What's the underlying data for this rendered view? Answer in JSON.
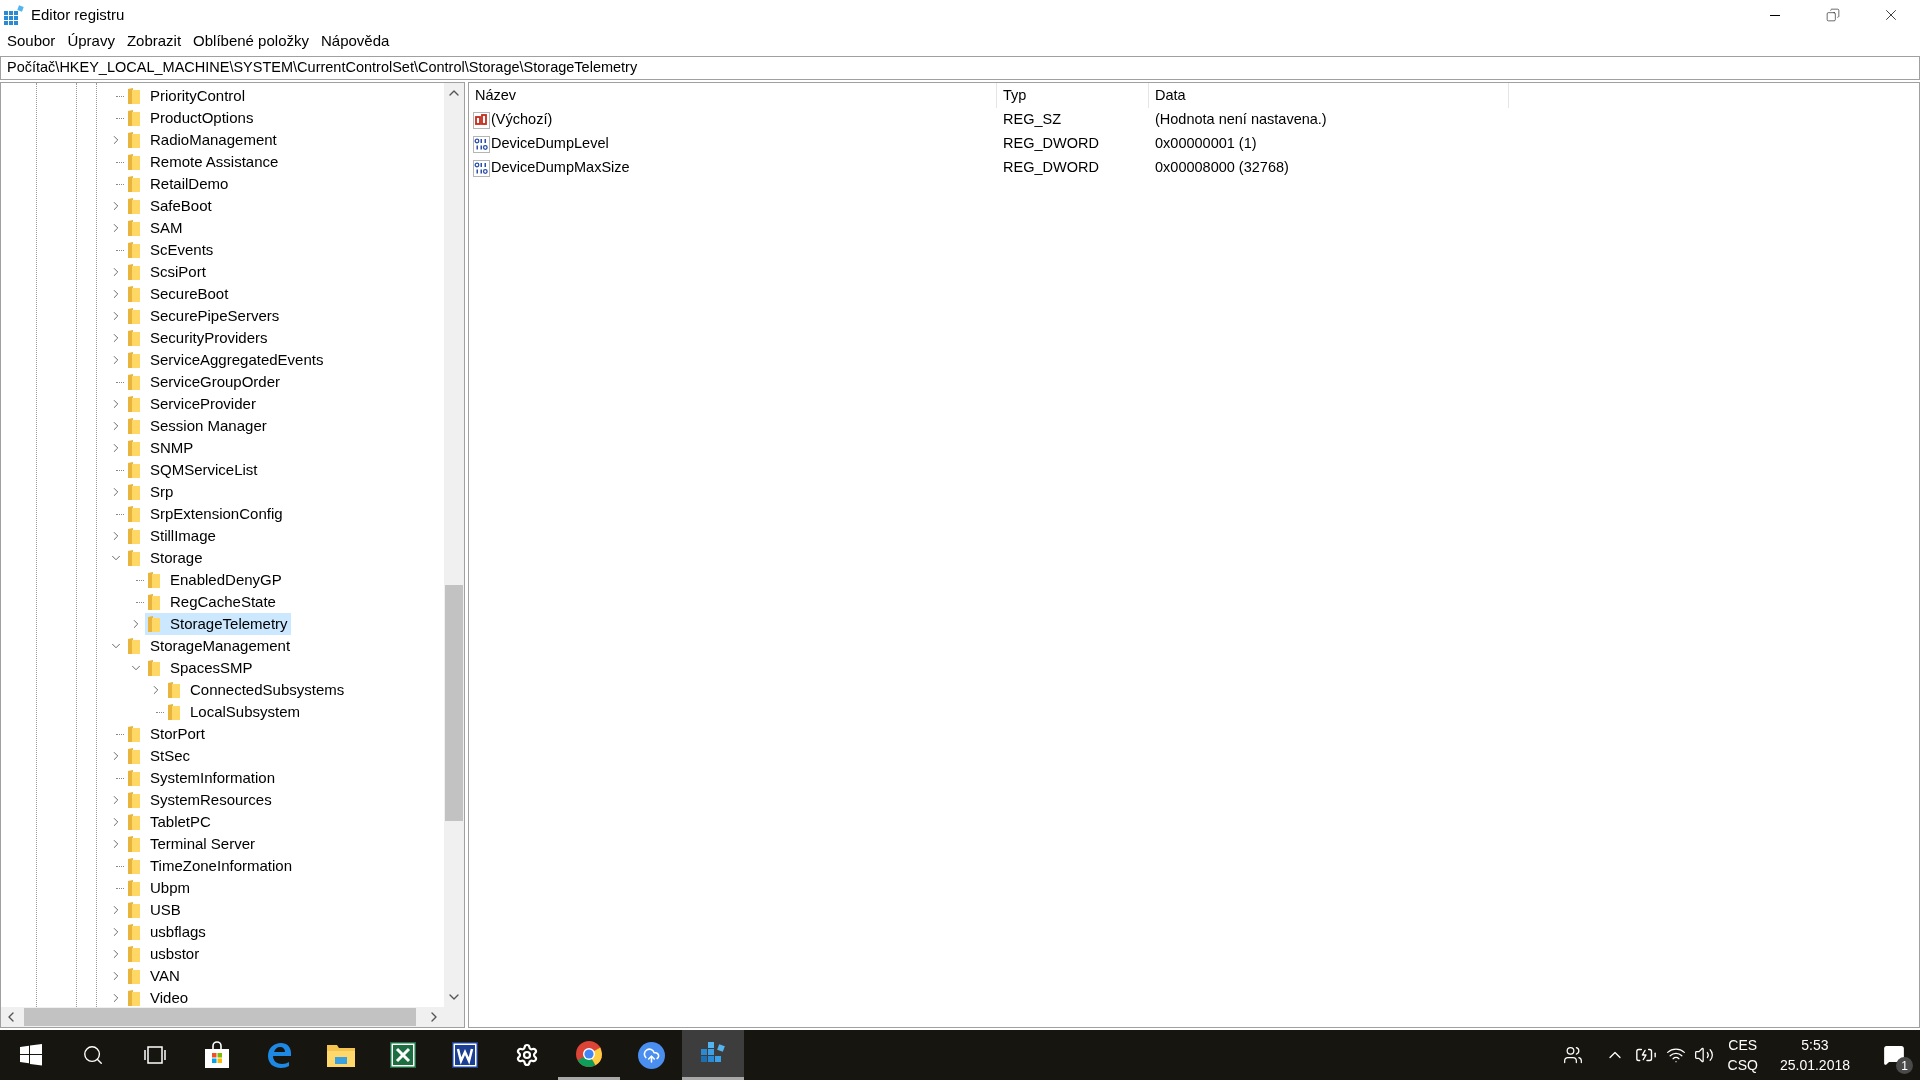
{
  "window": {
    "title": "Editor registru"
  },
  "menu": [
    "Soubor",
    "Úpravy",
    "Zobrazit",
    "Oblíbené položky",
    "Nápověda"
  ],
  "address": "Počítač\\HKEY_LOCAL_MACHINE\\SYSTEM\\CurrentControlSet\\Control\\Storage\\StorageTelemetry",
  "tree": [
    {
      "label": "PriorityControl",
      "expandable": false,
      "selected": false
    },
    {
      "label": "ProductOptions",
      "expandable": false,
      "selected": false
    },
    {
      "label": "RadioManagement",
      "expandable": true,
      "expanded": false,
      "selected": false
    },
    {
      "label": "Remote Assistance",
      "expandable": false,
      "selected": false
    },
    {
      "label": "RetailDemo",
      "expandable": false,
      "selected": false
    },
    {
      "label": "SafeBoot",
      "expandable": true,
      "expanded": false,
      "selected": false
    },
    {
      "label": "SAM",
      "expandable": true,
      "expanded": false,
      "selected": false
    },
    {
      "label": "ScEvents",
      "expandable": false,
      "selected": false
    },
    {
      "label": "ScsiPort",
      "expandable": true,
      "expanded": false,
      "selected": false
    },
    {
      "label": "SecureBoot",
      "expandable": true,
      "expanded": false,
      "selected": false
    },
    {
      "label": "SecurePipeServers",
      "expandable": true,
      "expanded": false,
      "selected": false
    },
    {
      "label": "SecurityProviders",
      "expandable": true,
      "expanded": false,
      "selected": false
    },
    {
      "label": "ServiceAggregatedEvents",
      "expandable": true,
      "expanded": false,
      "selected": false
    },
    {
      "label": "ServiceGroupOrder",
      "expandable": false,
      "selected": false
    },
    {
      "label": "ServiceProvider",
      "expandable": true,
      "expanded": false,
      "selected": false
    },
    {
      "label": "Session Manager",
      "expandable": true,
      "expanded": false,
      "selected": false
    },
    {
      "label": "SNMP",
      "expandable": true,
      "expanded": false,
      "selected": false
    },
    {
      "label": "SQMServiceList",
      "expandable": false,
      "selected": false
    },
    {
      "label": "Srp",
      "expandable": true,
      "expanded": false,
      "selected": false
    },
    {
      "label": "SrpExtensionConfig",
      "expandable": false,
      "selected": false
    },
    {
      "label": "StillImage",
      "expandable": true,
      "expanded": false,
      "selected": false
    },
    {
      "label": "Storage",
      "expandable": true,
      "expanded": true,
      "selected": false,
      "children": [
        {
          "label": "EnabledDenyGP",
          "expandable": false,
          "selected": false
        },
        {
          "label": "RegCacheState",
          "expandable": false,
          "selected": false
        },
        {
          "label": "StorageTelemetry",
          "expandable": true,
          "expanded": false,
          "selected": true
        }
      ]
    },
    {
      "label": "StorageManagement",
      "expandable": true,
      "expanded": true,
      "selected": false,
      "children": [
        {
          "label": "SpacesSMP",
          "expandable": true,
          "expanded": true,
          "selected": false,
          "children": [
            {
              "label": "ConnectedSubsystems",
              "expandable": true,
              "expanded": false,
              "selected": false
            },
            {
              "label": "LocalSubsystem",
              "expandable": false,
              "selected": false
            }
          ]
        }
      ]
    },
    {
      "label": "StorPort",
      "expandable": false,
      "selected": false
    },
    {
      "label": "StSec",
      "expandable": true,
      "expanded": false,
      "selected": false
    },
    {
      "label": "SystemInformation",
      "expandable": false,
      "selected": false
    },
    {
      "label": "SystemResources",
      "expandable": true,
      "expanded": false,
      "selected": false
    },
    {
      "label": "TabletPC",
      "expandable": true,
      "expanded": false,
      "selected": false
    },
    {
      "label": "Terminal Server",
      "expandable": true,
      "expanded": false,
      "selected": false
    },
    {
      "label": "TimeZoneInformation",
      "expandable": false,
      "selected": false
    },
    {
      "label": "Ubpm",
      "expandable": false,
      "selected": false
    },
    {
      "label": "USB",
      "expandable": true,
      "expanded": false,
      "selected": false
    },
    {
      "label": "usbflags",
      "expandable": true,
      "expanded": false,
      "selected": false
    },
    {
      "label": "usbstor",
      "expandable": true,
      "expanded": false,
      "selected": false
    },
    {
      "label": "VAN",
      "expandable": true,
      "expanded": false,
      "selected": false
    },
    {
      "label": "Video",
      "expandable": true,
      "expanded": false,
      "selected": false
    }
  ],
  "values": {
    "columns": [
      "Název",
      "Typ",
      "Data"
    ],
    "rows": [
      {
        "kind": "string",
        "name": "(Výchozí)",
        "type": "REG_SZ",
        "data": "(Hodnota není nastavena.)"
      },
      {
        "kind": "binary",
        "name": "DeviceDumpLevel",
        "type": "REG_DWORD",
        "data": "0x00000001 (1)"
      },
      {
        "kind": "binary",
        "name": "DeviceDumpMaxSize",
        "type": "REG_DWORD",
        "data": "0x00008000 (32768)"
      }
    ]
  },
  "taskbar": {
    "apps": [
      {
        "kind": "start",
        "running": false,
        "active": false
      },
      {
        "kind": "search",
        "running": false,
        "active": false
      },
      {
        "kind": "taskview",
        "running": false,
        "active": false
      },
      {
        "kind": "store",
        "running": false,
        "active": false
      },
      {
        "kind": "edge",
        "running": false,
        "active": false
      },
      {
        "kind": "explorer",
        "running": false,
        "active": false
      },
      {
        "kind": "sheet",
        "running": false,
        "active": false
      },
      {
        "kind": "doc",
        "running": false,
        "active": false
      },
      {
        "kind": "settings",
        "running": false,
        "active": false
      },
      {
        "kind": "chrome",
        "running": true,
        "active": false
      },
      {
        "kind": "cloud",
        "running": false,
        "active": false
      },
      {
        "kind": "registry",
        "running": true,
        "active": true
      }
    ],
    "language": [
      "CES",
      "CSQ"
    ],
    "time": "5:53",
    "date": "25.01.2018",
    "notifications": "1"
  }
}
